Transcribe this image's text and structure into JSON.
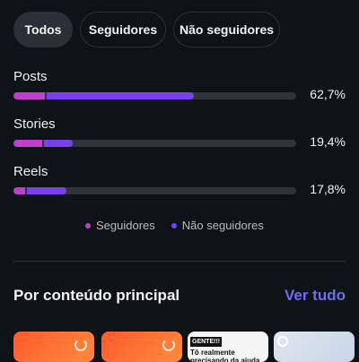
{
  "filters": {
    "tabs": [
      {
        "label": "Todos",
        "active": true
      },
      {
        "label": "Seguidores",
        "active": false
      },
      {
        "label": "Não seguidores",
        "active": false
      }
    ]
  },
  "metrics": [
    {
      "label": "Posts",
      "pct": "62,7%",
      "followers_fraction": 0.11,
      "non_followers_fraction": 0.52
    },
    {
      "label": "Stories",
      "pct": "19,4%",
      "followers_fraction": 0.1,
      "non_followers_fraction": 0.1
    },
    {
      "label": "Reels",
      "pct": "17,8%",
      "followers_fraction": 0.04,
      "non_followers_fraction": 0.14
    }
  ],
  "legend": {
    "followers": {
      "label": "Seguidores",
      "color": "#c13fd0"
    },
    "non_followers": {
      "label": "Não seguidores",
      "color": "#7b3ff2"
    }
  },
  "section": {
    "title": "Por conteúdo principal",
    "see_all": "Ver tudo"
  },
  "thumbnails": [
    {
      "type": "orange"
    },
    {
      "type": "orange"
    },
    {
      "type": "text",
      "top_text": "GENTE!!!",
      "text": "Tô realmente precisando da ajuda de vocês hoje"
    },
    {
      "type": "image"
    }
  ],
  "colors": {
    "background": "#0d1317",
    "accent": "#6e6df5"
  }
}
